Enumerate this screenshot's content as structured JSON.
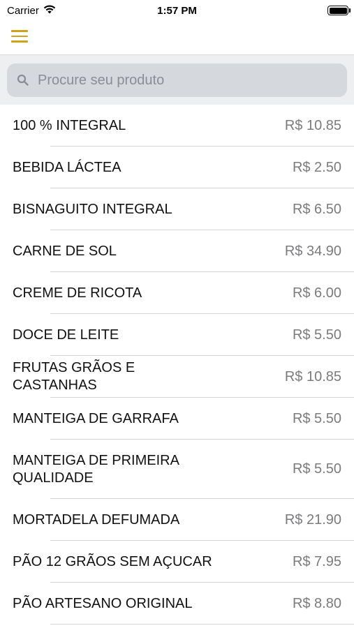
{
  "status_bar": {
    "carrier": "Carrier",
    "time": "1:57 PM"
  },
  "nav": {
    "menu_icon": "hamburger-menu-icon",
    "accent_color": "#d4a017"
  },
  "search": {
    "placeholder": "Procure seu produto",
    "value": ""
  },
  "products": [
    {
      "name": "100 % INTEGRAL",
      "price": "R$ 10.85"
    },
    {
      "name": "BEBIDA LÁCTEA",
      "price": "R$ 2.50"
    },
    {
      "name": "BISNAGUITO INTEGRAL",
      "price": "R$ 6.50"
    },
    {
      "name": "CARNE DE SOL",
      "price": "R$ 34.90"
    },
    {
      "name": "CREME DE RICOTA",
      "price": "R$ 6.00"
    },
    {
      "name": "DOCE DE LEITE",
      "price": "R$ 5.50"
    },
    {
      "name": "FRUTAS GRÃOS E CASTANHAS",
      "price": "R$ 10.85"
    },
    {
      "name": "MANTEIGA DE GARRAFA",
      "price": "R$ 5.50"
    },
    {
      "name": "MANTEIGA DE PRIMEIRA QUALIDADE",
      "price": "R$ 5.50"
    },
    {
      "name": "MORTADELA DEFUMADA",
      "price": "R$ 21.90"
    },
    {
      "name": "PÃO 12 GRÃOS SEM AÇUCAR",
      "price": "R$ 7.95"
    },
    {
      "name": "PÃO ARTESANO ORIGINAL",
      "price": "R$ 8.80"
    }
  ]
}
